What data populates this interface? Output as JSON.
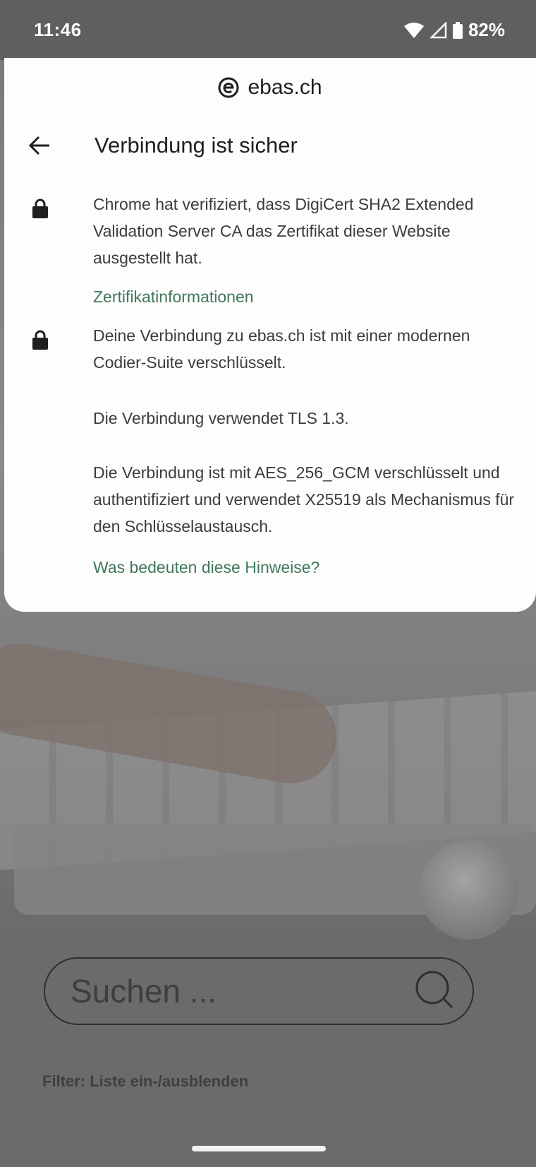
{
  "status_bar": {
    "time": "11:46",
    "battery": "82%",
    "icons": [
      "wifi-icon",
      "cell-signal-icon",
      "battery-icon"
    ]
  },
  "site": {
    "domain": "ebas.ch",
    "favicon": "ebas-logo-icon"
  },
  "panel": {
    "title": "Verbindung ist sicher",
    "certificate_text": "Chrome hat verifiziert, dass DigiCert SHA2 Extended Validation Server CA das Zertifikat dieser Website ausgestellt hat.",
    "certificate_link": "Zertifikatinformationen",
    "connection_text": "Deine Verbindung zu ebas.ch ist mit einer modernen Codier-Suite verschlüsselt.",
    "tls_text": "Die Verbindung verwendet TLS 1.3.",
    "cipher_text": "Die Verbindung ist mit AES_256_GCM verschlüsselt und authentifiziert und verwendet X25519 als Mechanismus für den Schlüsselaustausch.",
    "help_link": "Was bedeuten diese Hinweise?"
  },
  "background_page": {
    "search_placeholder": "Suchen ...",
    "filter_link": "Filter: Liste ein-/ausblenden"
  },
  "colors": {
    "link": "#41785a",
    "sheet_bg": "#fdfdfd",
    "scrim": "#6b6b6b"
  }
}
